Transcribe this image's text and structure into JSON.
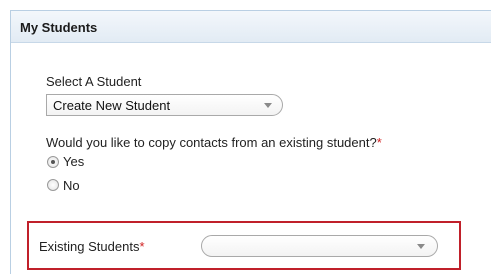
{
  "panel": {
    "title": "My Students"
  },
  "select_student": {
    "label": "Select A Student",
    "value": "Create New Student"
  },
  "copy_contacts": {
    "question": "Would you like to copy contacts from an existing student?",
    "required_mark": "*",
    "options": [
      {
        "label": "Yes",
        "selected": true
      },
      {
        "label": "No",
        "selected": false
      }
    ]
  },
  "existing_students": {
    "label": "Existing Students",
    "required_mark": "*",
    "value": ""
  },
  "colors": {
    "highlight_border": "#c0202a",
    "required": "#d02020",
    "header_bg": "#e2ebf4"
  }
}
